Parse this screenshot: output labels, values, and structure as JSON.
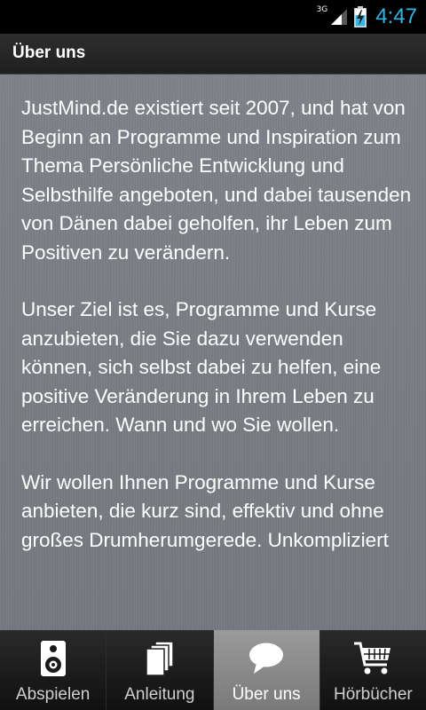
{
  "status_bar": {
    "network": "3G",
    "time": "4:47"
  },
  "header": {
    "title": "Über uns"
  },
  "content": {
    "paragraphs": [
      "JustMind.de existiert seit 2007, und hat von Beginn an Programme und Inspiration zum Thema Persönliche Entwicklung und Selbsthilfe angeboten, und dabei tausenden von Dänen dabei geholfen, ihr Leben zum Positiven zu verändern.",
      "Unser Ziel ist es, Programme und Kurse anzubieten, die Sie dazu verwenden können, sich selbst dabei zu helfen, eine positive Veränderung in Ihrem Leben zu erreichen. Wann und wo Sie wollen.",
      "Wir wollen Ihnen Programme und Kurse anbieten, die kurz sind, effektiv und ohne großes Drumherumgerede. Unkompliziert"
    ]
  },
  "tabs": [
    {
      "label": "Abspielen",
      "icon": "speaker-icon",
      "active": false
    },
    {
      "label": "Anleitung",
      "icon": "pages-icon",
      "active": false
    },
    {
      "label": "Über uns",
      "icon": "speech-bubble-icon",
      "active": true
    },
    {
      "label": "Hörbücher",
      "icon": "cart-icon",
      "active": false
    }
  ],
  "colors": {
    "clock": "#33b5e5",
    "content_background": "#787c82",
    "active_tab": "#8a8a8a"
  }
}
